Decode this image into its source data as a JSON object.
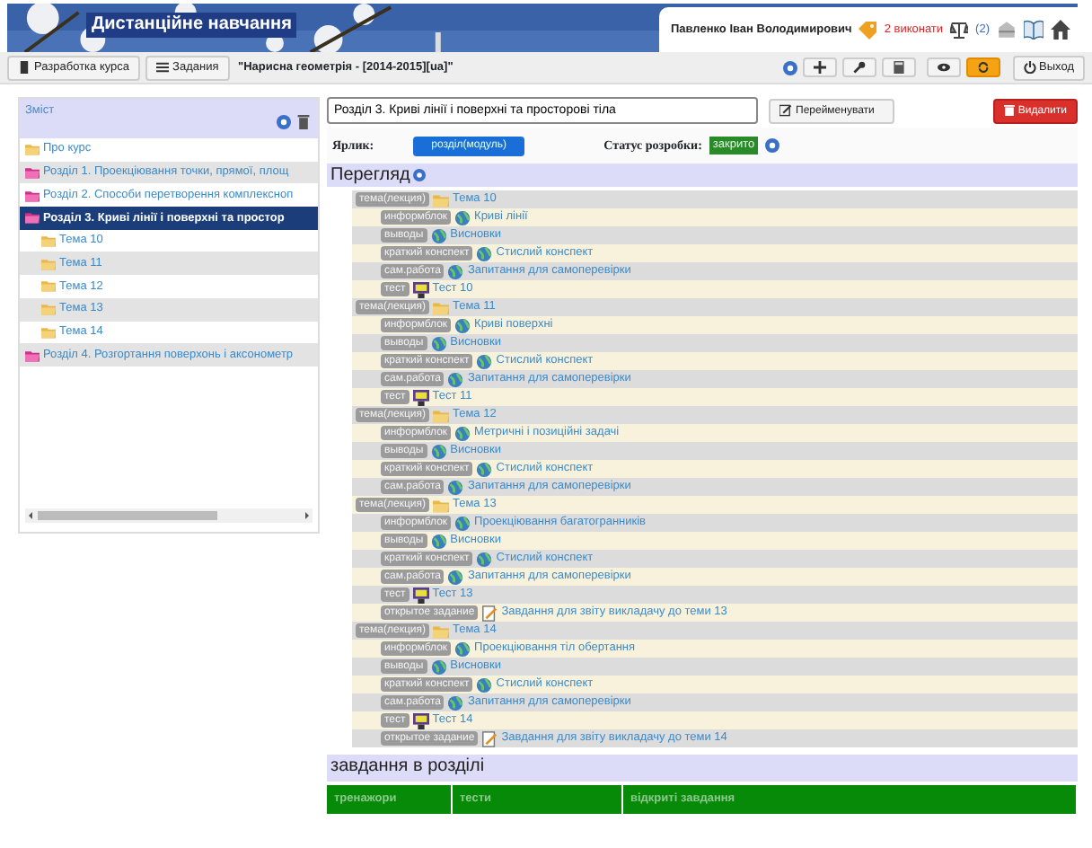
{
  "header": {
    "title": "Дистанційне навчання",
    "user": "Павленко Іван Володимирович",
    "tasks": "2 виконати",
    "messages": "(2)"
  },
  "toolbar": {
    "buttons": [
      "Разработка курса",
      "Задания"
    ],
    "course": "\"Нарисна геометрія - [2014-2015][ua]\"",
    "exit": "Выход"
  },
  "sidebar": {
    "title": "Зміст",
    "items": [
      {
        "label": "Про курс",
        "kind": "folder",
        "selected": false
      },
      {
        "label": "Розділ 1. Проекціювання точки, прямої, площ",
        "kind": "section",
        "selected": false
      },
      {
        "label": "Розділ 2. Способи перетворення комплексноп",
        "kind": "section",
        "selected": false
      },
      {
        "label": "Розділ 3. Криві лінії і поверхні та простор",
        "kind": "section",
        "selected": true,
        "children": [
          {
            "label": "Тема 10",
            "kind": "folder",
            "selected": false
          },
          {
            "label": "Тема 11",
            "kind": "folder",
            "selected": false
          },
          {
            "label": "Тема 12",
            "kind": "folder",
            "selected": false
          },
          {
            "label": "Тема 13",
            "kind": "folder",
            "selected": false
          },
          {
            "label": "Тема 14",
            "kind": "folder",
            "selected": false
          }
        ]
      },
      {
        "label": "Розділ 4. Розгортання поверхонь і аксонометр",
        "kind": "section",
        "selected": false
      }
    ]
  },
  "editor": {
    "name_value": "Розділ 3. Криві лінії і поверхні та просторові тіла",
    "rename": "Перейменувати",
    "delete": "Видалити",
    "label_caption": "Ярлик:",
    "label_value": "розділ(модуль)",
    "status_caption": "Статус розробки:",
    "status": "закрито"
  },
  "overview": {
    "title": "Перегляд",
    "topics": [
      {
        "tag": "тема(лекция)",
        "title": "Тема 10",
        "children": [
          {
            "tag": "информблок",
            "kind": "page",
            "title": "Криві лінії"
          },
          {
            "tag": "выводы",
            "kind": "page",
            "title": "Висновки"
          },
          {
            "tag": "краткий конспект",
            "kind": "page",
            "title": "Стислий конспект"
          },
          {
            "tag": "сам.работа",
            "kind": "page",
            "title": "Запитання для самоперевірки"
          },
          {
            "tag": "тест",
            "kind": "test",
            "title": "Тест 10"
          }
        ]
      },
      {
        "tag": "тема(лекция)",
        "title": "Тема 11",
        "children": [
          {
            "tag": "информблок",
            "kind": "page",
            "title": "Криві поверхні"
          },
          {
            "tag": "выводы",
            "kind": "page",
            "title": "Висновки"
          },
          {
            "tag": "краткий конспект",
            "kind": "page",
            "title": "Стислий конспект"
          },
          {
            "tag": "сам.работа",
            "kind": "page",
            "title": "Запитання для самоперевірки"
          },
          {
            "tag": "тест",
            "kind": "test",
            "title": "Тест 11"
          }
        ]
      },
      {
        "tag": "тема(лекция)",
        "title": "Тема 12",
        "children": [
          {
            "tag": "информблок",
            "kind": "page",
            "title": "Метричні і позиційні задачі"
          },
          {
            "tag": "выводы",
            "kind": "page",
            "title": "Висновки"
          },
          {
            "tag": "краткий конспект",
            "kind": "page",
            "title": "Стислий конспект"
          },
          {
            "tag": "сам.работа",
            "kind": "page",
            "title": "Запитання для самоперевірки"
          }
        ]
      },
      {
        "tag": "тема(лекция)",
        "title": "Тема 13",
        "children": [
          {
            "tag": "информблок",
            "kind": "page",
            "title": "Проекціювання багатогранників"
          },
          {
            "tag": "выводы",
            "kind": "page",
            "title": "Висновки"
          },
          {
            "tag": "краткий конспект",
            "kind": "page",
            "title": "Стислий конспект"
          },
          {
            "tag": "сам.работа",
            "kind": "page",
            "title": "Запитання для самоперевірки"
          },
          {
            "tag": "тест",
            "kind": "test",
            "title": "Тест 13"
          },
          {
            "tag": "открытое задание",
            "kind": "task",
            "title": "Завдання для звіту викладачу до теми 13"
          }
        ]
      },
      {
        "tag": "тема(лекция)",
        "title": "Тема 14",
        "children": [
          {
            "tag": "информблок",
            "kind": "page",
            "title": "Проекціювання тіл обертання"
          },
          {
            "tag": "выводы",
            "kind": "page",
            "title": "Висновки"
          },
          {
            "tag": "краткий конспект",
            "kind": "page",
            "title": "Стислий конспект"
          },
          {
            "tag": "сам.работа",
            "kind": "page",
            "title": "Запитання для самоперевірки"
          },
          {
            "tag": "тест",
            "kind": "test",
            "title": "Тест 14"
          },
          {
            "tag": "открытое задание",
            "kind": "task",
            "title": "Завдання для звіту викладачу до теми 14"
          }
        ]
      }
    ]
  },
  "tasks_section": {
    "title": "завдання в розділі",
    "columns": [
      "тренажори",
      "тести",
      "відкриті завдання"
    ]
  }
}
